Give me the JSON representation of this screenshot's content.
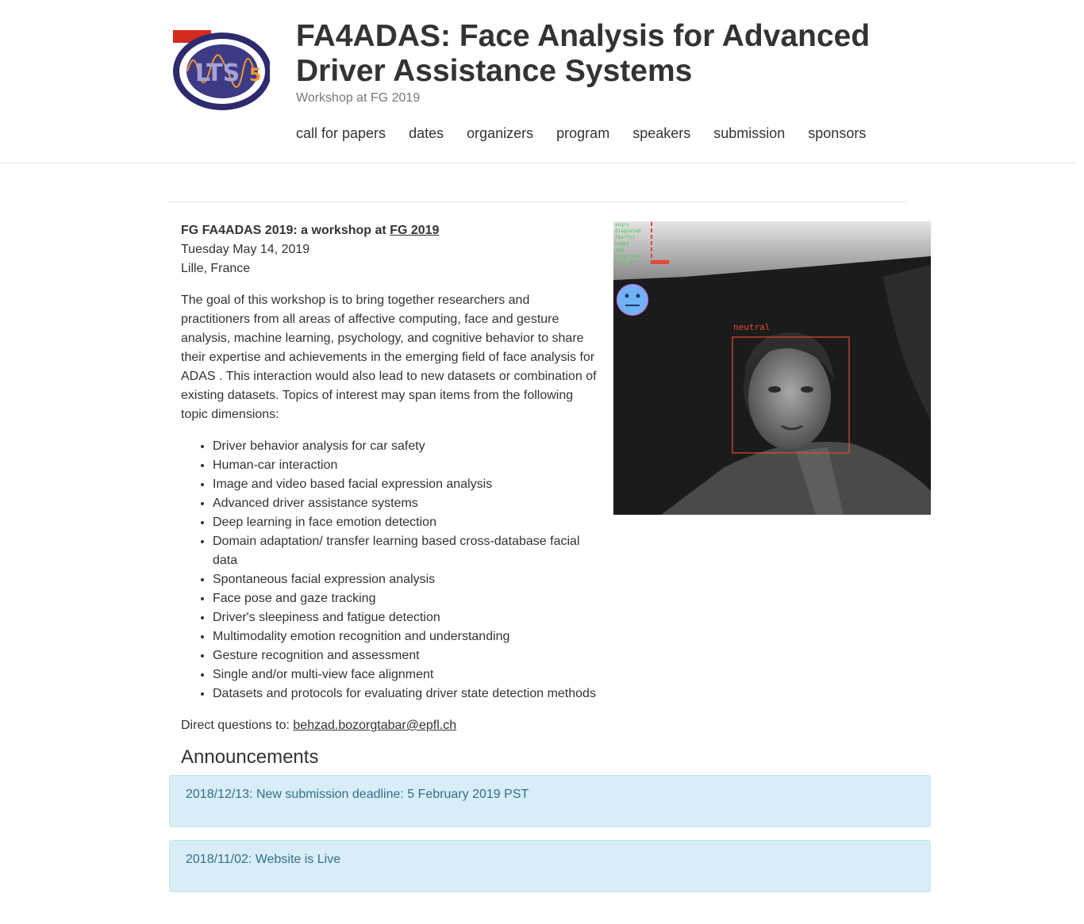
{
  "header": {
    "logo_text": "LTS5",
    "title": "FA4ADAS: Face Analysis for Advanced Driver Assistance Systems",
    "subtitle": "Workshop at FG 2019",
    "nav": [
      "call for papers",
      "dates",
      "organizers",
      "program",
      "speakers",
      "submission",
      "sponsors"
    ]
  },
  "intro": {
    "heading_prefix": "FG FA4ADAS 2019: a workshop at ",
    "heading_link": "FG 2019",
    "date": "Tuesday May 14, 2019",
    "location": "Lille, France",
    "goal": "The goal of this workshop is to bring together researchers and practitioners from all areas of affective computing, face and gesture analysis, machine learning, psychology, and cognitive behavior to share their expertise and achievements in the emerging field of face analysis for ADAS . This interaction would also lead to new datasets or combination of existing datasets. Topics of interest may span items from the following topic dimensions:",
    "topics": [
      "Driver behavior analysis for car safety",
      "Human-car interaction",
      "Image and video based facial expression analysis",
      "Advanced driver assistance systems",
      "Deep learning in face emotion detection",
      "Domain adaptation/ transfer learning based cross-database facial data",
      "Spontaneous facial expression analysis",
      "Face pose and gaze tracking",
      "Driver's sleepiness and fatigue detection",
      "Multimodality emotion recognition and understanding",
      "Gesture recognition and assessment",
      "Single and/or multi-view face alignment",
      "Datasets and protocols for evaluating driver state detection methods"
    ],
    "questions_label": "Direct questions to: ",
    "questions_email": "behzad.bozorgtabar@epfl.ch"
  },
  "photo": {
    "emotions": [
      "angry",
      "disgusted",
      "fearful",
      "happy",
      "sad",
      "surprised",
      "neutral"
    ],
    "emotion_levels": [
      0.03,
      0.03,
      0.08,
      0.03,
      0.03,
      0.03,
      0.9
    ],
    "detected_label": "neutral"
  },
  "announcements": {
    "title": "Announcements",
    "items": [
      "2018/12/13: New submission deadline: 5 February 2019 PST",
      "2018/11/02: Website is Live"
    ]
  }
}
